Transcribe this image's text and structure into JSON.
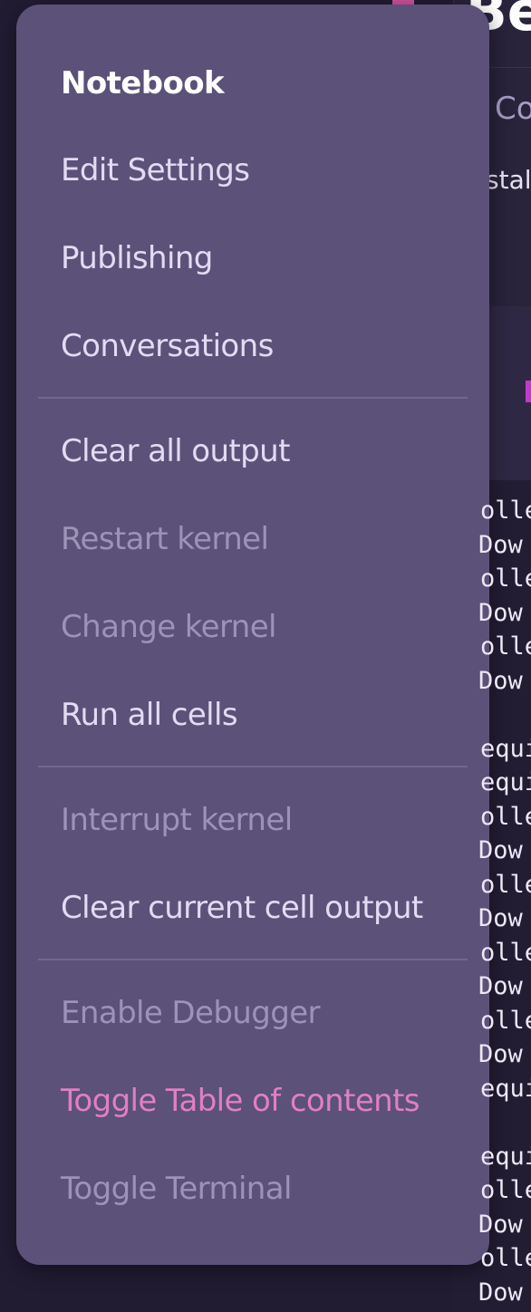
{
  "background": {
    "notebook_title_fragment": "Be",
    "tab_fragment": "Co",
    "text_fragment": "stal",
    "output_lines": [
      "olle",
      " Dow",
      "olle",
      " Dow",
      "olle",
      " Dow",
      "",
      "equi",
      "equi",
      "olle",
      " Dow",
      "olle",
      " Dow",
      "olle",
      " Dow",
      "olle",
      " Dow",
      "equi",
      "",
      "equi",
      "olle",
      " Dow",
      "olle",
      " Dow"
    ]
  },
  "menu": {
    "header": "Notebook",
    "groups": [
      [
        {
          "label": "Edit Settings",
          "state": "enabled"
        },
        {
          "label": "Publishing",
          "state": "enabled"
        },
        {
          "label": "Conversations",
          "state": "enabled"
        }
      ],
      [
        {
          "label": "Clear all output",
          "state": "enabled"
        },
        {
          "label": "Restart kernel",
          "state": "disabled"
        },
        {
          "label": "Change kernel",
          "state": "disabled"
        },
        {
          "label": "Run all cells",
          "state": "enabled"
        }
      ],
      [
        {
          "label": "Interrupt kernel",
          "state": "disabled"
        },
        {
          "label": "Clear current cell output",
          "state": "enabled"
        }
      ],
      [
        {
          "label": "Enable Debugger",
          "state": "disabled"
        },
        {
          "label": "Toggle Table of contents",
          "state": "accent"
        },
        {
          "label": "Toggle Terminal",
          "state": "disabled"
        }
      ]
    ]
  },
  "colors": {
    "menu_background": "#5c5178",
    "enabled_text": "#e2dbf3",
    "disabled_text": "#9d93b7",
    "accent_text": "#e07fc4",
    "page_background": "#221c33"
  }
}
